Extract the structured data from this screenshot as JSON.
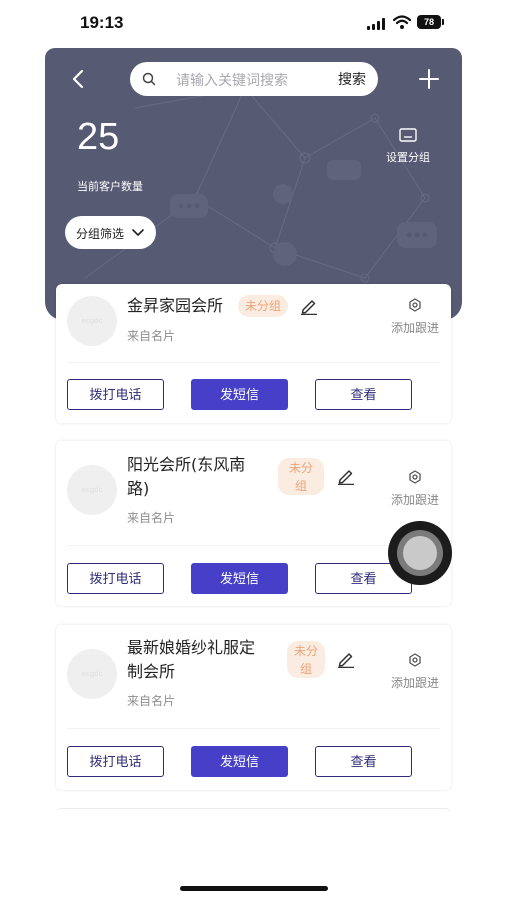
{
  "status_bar": {
    "time": "19:13",
    "battery": "78"
  },
  "header": {
    "search_placeholder": "请输入关键词搜索",
    "search_button": "搜索",
    "customer_count": "25",
    "customer_count_label": "当前客户数量",
    "set_group_label": "设置分组",
    "filter_label": "分组筛选"
  },
  "customers": [
    {
      "name_line1": "金昇家园会所",
      "name_line2": "",
      "tag_line1": "未分组",
      "tag_line2": "",
      "source": "来自名片",
      "follow_label": "添加跟进",
      "avatar_text": "ecgdc",
      "call_label": "拨打电话",
      "sms_label": "发短信",
      "view_label": "查看"
    },
    {
      "name_line1": "阳光会所(东风南",
      "name_line2": "路)",
      "tag_line1": "未分",
      "tag_line2": "组",
      "source": "来自名片",
      "follow_label": "添加跟进",
      "avatar_text": "ecgdc",
      "call_label": "拨打电话",
      "sms_label": "发短信",
      "view_label": "查看"
    },
    {
      "name_line1": "最新娘婚纱礼服定",
      "name_line2": "制会所",
      "tag_line1": "未分",
      "tag_line2": "组",
      "source": "来自名片",
      "follow_label": "添加跟进",
      "avatar_text": "ecgdc",
      "call_label": "拨打电话",
      "sms_label": "发短信",
      "view_label": "查看"
    }
  ],
  "colors": {
    "header_bg": "#565a72",
    "primary": "#4640c8",
    "outline": "#2f2c7a",
    "tag_text": "#eba478",
    "tag_bg": "#fbece2"
  },
  "icons": [
    "back-arrow-icon",
    "search-icon",
    "plus-icon",
    "group-settings-icon",
    "chevron-down-icon",
    "edit-pencil-icon",
    "gear-icon"
  ]
}
